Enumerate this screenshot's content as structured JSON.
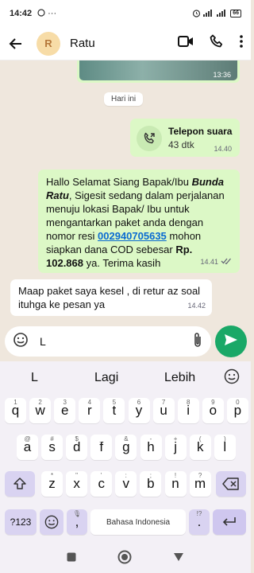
{
  "status_bar": {
    "time": "14:42",
    "battery": "66"
  },
  "header": {
    "avatar_letter": "R",
    "contact_name": "Ratu"
  },
  "chat": {
    "image_message": {
      "time": "13:36"
    },
    "date_label": "Hari ini",
    "call_message": {
      "title": "Telepon suara",
      "duration": "43 dtk",
      "time": "14.40"
    },
    "outgoing_message": {
      "text_1": "Hallo Selamat Siang Bapak/Ibu ",
      "name": "Bunda Ratu",
      "text_2": ", Sigesit sedang dalam perjalanan menuju lokasi Bapak/ Ibu untuk mengantarkan paket anda dengan nomor resi ",
      "tracking_number": "002940705635",
      "text_3": " mohon siapkan dana COD sebesar ",
      "amount": "Rp. 102.868",
      "text_4": " ya. Terima kasih",
      "time": "14.41"
    },
    "incoming_message": {
      "text": "Maap paket saya kesel , di retur az soal ituhga ke pesan ya",
      "time": "14.42"
    }
  },
  "input": {
    "value": "L"
  },
  "suggestions": [
    "L",
    "Lagi",
    "Lebih"
  ],
  "keyboard": {
    "row1": [
      {
        "k": "q",
        "h": "1"
      },
      {
        "k": "w",
        "h": "2"
      },
      {
        "k": "e",
        "h": "3"
      },
      {
        "k": "r",
        "h": "4"
      },
      {
        "k": "t",
        "h": "5"
      },
      {
        "k": "y",
        "h": "6"
      },
      {
        "k": "u",
        "h": "7"
      },
      {
        "k": "i",
        "h": "8"
      },
      {
        "k": "o",
        "h": "9"
      },
      {
        "k": "p",
        "h": "0"
      }
    ],
    "row2": [
      {
        "k": "a",
        "h": "@"
      },
      {
        "k": "s",
        "h": "#"
      },
      {
        "k": "d",
        "h": "$"
      },
      {
        "k": "f",
        "h": "_"
      },
      {
        "k": "g",
        "h": "&"
      },
      {
        "k": "h",
        "h": "-"
      },
      {
        "k": "j",
        "h": "+"
      },
      {
        "k": "k",
        "h": "("
      },
      {
        "k": "l",
        "h": ")"
      }
    ],
    "row3": [
      {
        "k": "z",
        "h": "*"
      },
      {
        "k": "x",
        "h": "\""
      },
      {
        "k": "c",
        "h": "'"
      },
      {
        "k": "v",
        "h": ":"
      },
      {
        "k": "b",
        "h": ";"
      },
      {
        "k": "n",
        "h": "!"
      },
      {
        "k": "m",
        "h": "?"
      }
    ],
    "symbols_label": "?123",
    "comma": ",",
    "space_label": "Bahasa Indonesia",
    "period": ".",
    "period_hint": "!?"
  }
}
